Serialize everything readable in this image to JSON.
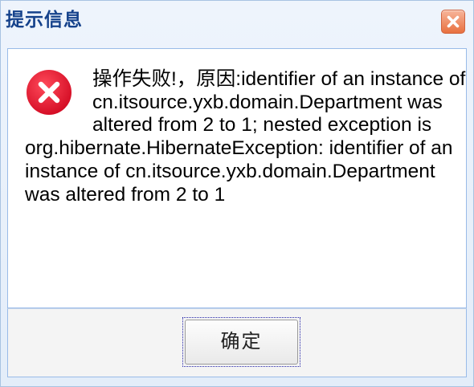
{
  "dialog": {
    "title": "提示信息",
    "close_icon": "close-icon",
    "error_icon": "error-icon",
    "message": "操作失败!，原因:identifier of an instance of cn.itsource.yxb.domain.Department was altered from 2 to 1; nested exception is org.hibernate.HibernateException: identifier of an instance of cn.itsource.yxb.domain.Department was altered from 2 to 1",
    "ok_label": "确定",
    "colors": {
      "title": "#15428b",
      "close_button": "#e8703f",
      "error_icon": "#e0142c",
      "border": "#99bbe8"
    }
  }
}
